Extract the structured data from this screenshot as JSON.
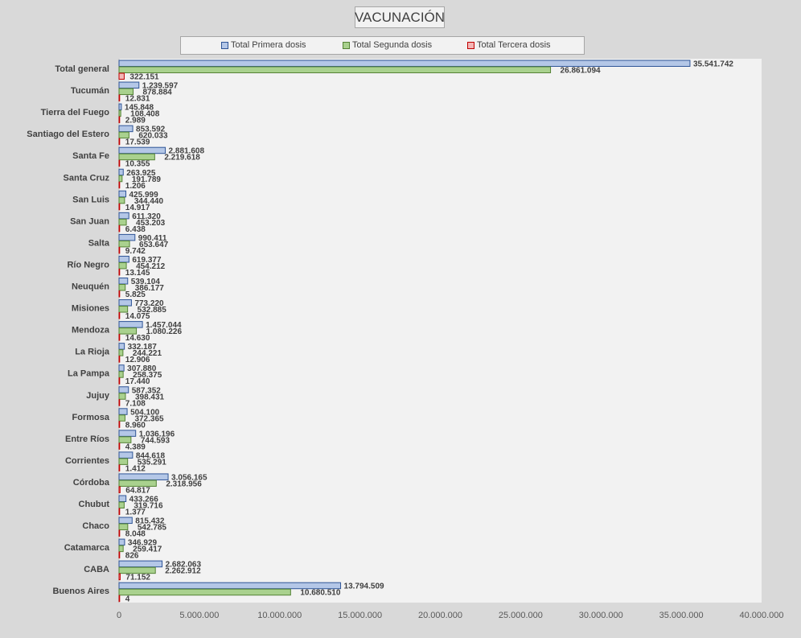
{
  "chart_data": {
    "type": "bar",
    "orientation": "horizontal",
    "title": "VACUNACIÓN",
    "categories": [
      "Total general",
      "Tucumán",
      "Tierra del Fuego",
      "Santiago del Estero",
      "Santa Fe",
      "Santa Cruz",
      "San Luis",
      "San Juan",
      "Salta",
      "Río Negro",
      "Neuquén",
      "Misiones",
      "Mendoza",
      "La Rioja",
      "La Pampa",
      "Jujuy",
      "Formosa",
      "Entre Ríos",
      "Corrientes",
      "Córdoba",
      "Chubut",
      "Chaco",
      "Catamarca",
      "CABA",
      "Buenos Aires"
    ],
    "series": [
      {
        "name": "Total Primera dosis",
        "color": "#b4c7e7",
        "border": "#2f5597",
        "values": [
          35541742,
          1239597,
          145848,
          853592,
          2881608,
          263925,
          425999,
          611320,
          990411,
          619377,
          539104,
          773220,
          1457044,
          332187,
          307880,
          587352,
          504100,
          1036196,
          844618,
          3056165,
          433266,
          815432,
          346929,
          2682063,
          13794509
        ],
        "labels": [
          "35.541.742",
          "1.239.597",
          "145.848",
          "853.592",
          "2.881.608",
          "263.925",
          "425.999",
          "611.320",
          "990.411",
          "619.377",
          "539.104",
          "773.220",
          "1.457.044",
          "332.187",
          "307.880",
          "587.352",
          "504.100",
          "1.036.196",
          "844.618",
          "3.056.165",
          "433.266",
          "815.432",
          "346.929",
          "2.682.063",
          "13.794.509"
        ]
      },
      {
        "name": "Total Segunda dosis",
        "color": "#a9d18e",
        "border": "#548235",
        "values": [
          26861094,
          878884,
          108408,
          620033,
          2219618,
          191789,
          344440,
          453203,
          653647,
          454212,
          386177,
          532885,
          1080226,
          244221,
          258375,
          398431,
          372365,
          744593,
          535291,
          2318956,
          319716,
          542785,
          259417,
          2262912,
          10680510
        ],
        "labels": [
          "26.861.094",
          "878.884",
          "108.408",
          "620.033",
          "2.219.618",
          "191.789",
          "344.440",
          "453.203",
          "653.647",
          "454.212",
          "386.177",
          "532.885",
          "1.080.226",
          "244.221",
          "258.375",
          "398.431",
          "372.365",
          "744.593",
          "535.291",
          "2.318.956",
          "319.716",
          "542.785",
          "259.417",
          "2.262.912",
          "10.680.510"
        ]
      },
      {
        "name": "Total Tercera dosis",
        "color": "#f4b6b6",
        "border": "#c00000",
        "values": [
          322151,
          12831,
          2989,
          17539,
          10355,
          1206,
          14917,
          6438,
          9742,
          13145,
          5825,
          14075,
          14630,
          12906,
          17440,
          7108,
          8960,
          4389,
          1412,
          64817,
          1377,
          8048,
          826,
          71152,
          4
        ],
        "labels": [
          "322.151",
          "12.831",
          "2.989",
          "17.539",
          "10.355",
          "1.206",
          "14.917",
          "6.438",
          "9.742",
          "13.145",
          "5.825",
          "14.075",
          "14.630",
          "12.906",
          "17.440",
          "7.108",
          "8.960",
          "4.389",
          "1.412",
          "64.817",
          "1.377",
          "8.048",
          "826",
          "71.152",
          "4"
        ]
      }
    ],
    "xlim": [
      0,
      40000000
    ],
    "xticks": [
      0,
      5000000,
      10000000,
      15000000,
      20000000,
      25000000,
      30000000,
      35000000,
      40000000
    ],
    "xtick_labels": [
      "0",
      "5.000.000",
      "10.000.000",
      "15.000.000",
      "20.000.000",
      "25.000.000",
      "30.000.000",
      "35.000.000",
      "40.000.000"
    ],
    "grid": false,
    "legend_position": "top"
  }
}
